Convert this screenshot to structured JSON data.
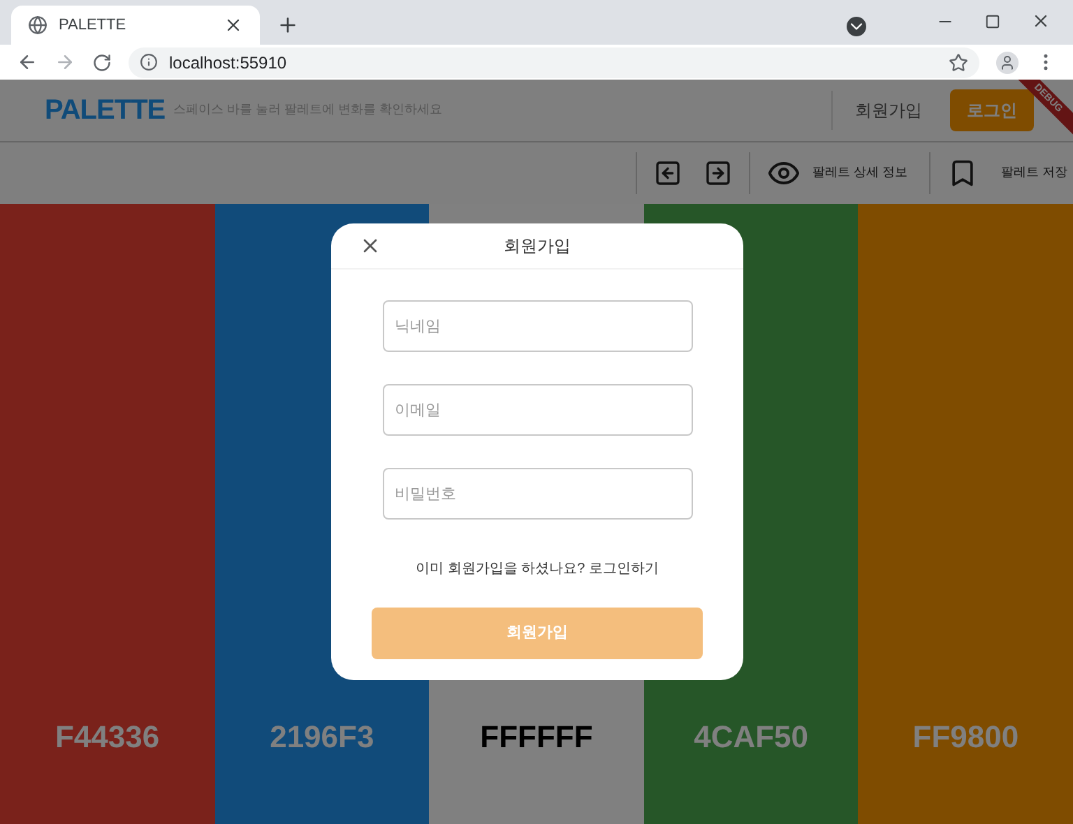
{
  "browser": {
    "tab_title": "PALETTE",
    "url": "localhost:55910"
  },
  "header": {
    "logo": "PALETTE",
    "hint": "스페이스 바를 눌러 팔레트에 변화를 확인하세요",
    "signup": "회원가입",
    "login": "로그인",
    "debug_banner": "DEBUG"
  },
  "toolbar": {
    "details": "팔레트 상세 정보",
    "save": "팔레트 저장"
  },
  "swatches": [
    {
      "label": "F44336",
      "color": "#7a221b"
    },
    {
      "label": "2196F3",
      "color": "#114b7a"
    },
    {
      "label": "FFFFFF",
      "color": "#808080"
    },
    {
      "label": "4CAF50",
      "color": "#265628"
    },
    {
      "label": "FF9800",
      "color": "#7f4c00"
    }
  ],
  "dialog": {
    "title": "회원가입",
    "fields": [
      {
        "placeholder": "닉네임"
      },
      {
        "placeholder": "이메일"
      },
      {
        "placeholder": "비밀번호"
      }
    ],
    "login_prompt": "이미 회원가입을 하셨나요? 로그인하기",
    "submit": "회원가입"
  }
}
